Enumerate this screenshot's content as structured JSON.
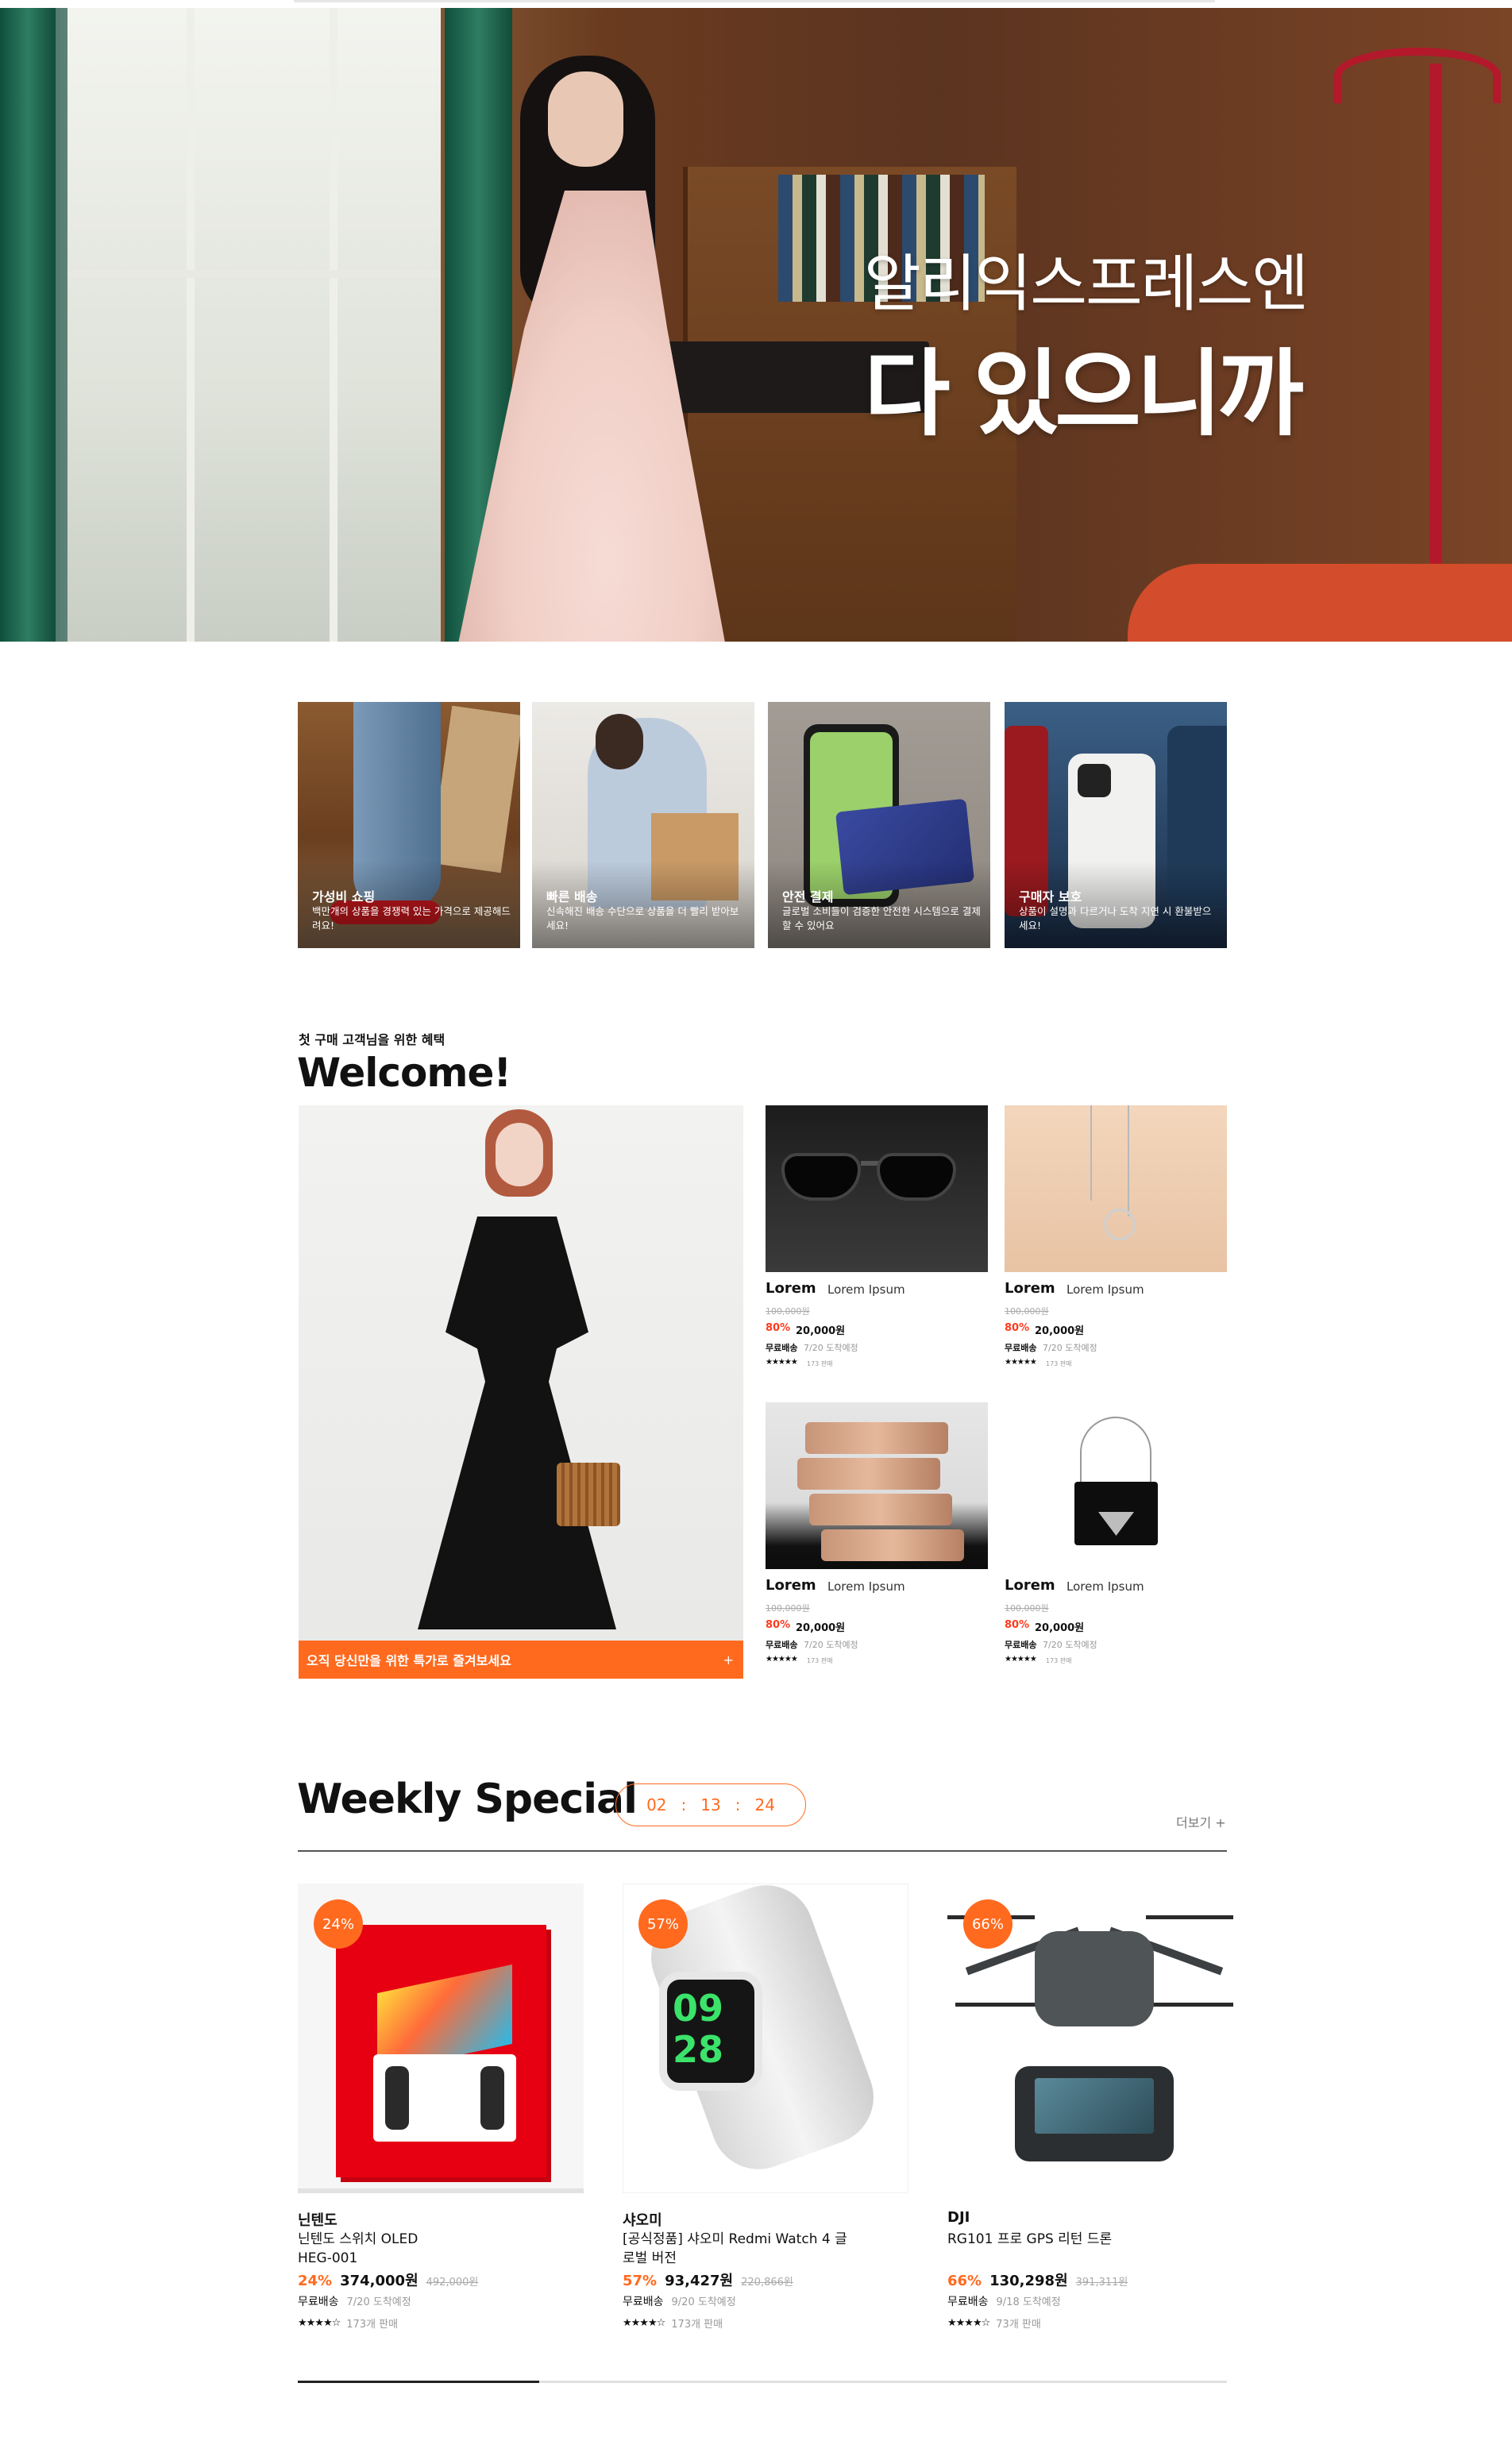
{
  "hero": {
    "title": "알리익스프레스엔",
    "subtitle": "다 있으니까"
  },
  "features": [
    {
      "title": "가성비 쇼핑",
      "desc": "백만개의 상품을 경쟁력 있는 가격으로 제공해드려요!"
    },
    {
      "title": "빠른 배송",
      "desc": "신속해진 배송 수단으로 상품을 더 빨리 받아보세요!"
    },
    {
      "title": "안전 결제",
      "desc": "글로벌 소비들이 검증한 안전한 시스템으로 결제할 수 있어요"
    },
    {
      "title": "구매자 보호",
      "desc": "상품이 설명과 다르거나 도착 지연 시 환불받으세요!"
    }
  ],
  "welcome": {
    "subtitle": "첫 구매 고객님을 위한 혜택",
    "title": "Welcome!",
    "cta": "오직 당신만을 위한 특가로 즐겨보세요",
    "cta_plus": "+",
    "products": [
      {
        "brand": "Lorem",
        "name": "Lorem Ipsum",
        "orig_price": "100,000원",
        "discount": "80%",
        "price": "20,000원",
        "shipping": "무료배송",
        "eta": "7/20 도착예정",
        "stars": "★★★★★",
        "sold": "173 판매"
      },
      {
        "brand": "Lorem",
        "name": "Lorem Ipsum",
        "orig_price": "100,000원",
        "discount": "80%",
        "price": "20,000원",
        "shipping": "무료배송",
        "eta": "7/20 도착예정",
        "stars": "★★★★★",
        "sold": "173 판매"
      },
      {
        "brand": "Lorem",
        "name": "Lorem Ipsum",
        "orig_price": "100,000원",
        "discount": "80%",
        "price": "20,000원",
        "shipping": "무료배송",
        "eta": "7/20 도착예정",
        "stars": "★★★★★",
        "sold": "173 판매"
      },
      {
        "brand": "Lorem",
        "name": "Lorem Ipsum",
        "orig_price": "100,000원",
        "discount": "80%",
        "price": "20,000원",
        "shipping": "무료배송",
        "eta": "7/20 도착예정",
        "stars": "★★★★★",
        "sold": "173 판매"
      }
    ]
  },
  "weekly": {
    "title": "Weekly Special",
    "timer": {
      "h": "02",
      "m": "13",
      "s": "24",
      "sep": ":"
    },
    "more": "더보기 +",
    "progress": 0.26,
    "products": [
      {
        "badge": "24%",
        "brand": "닌텐도",
        "name": "닌텐도 스위치 OLED HEG-001",
        "discount": "24%",
        "price": "374,000원",
        "orig_price": "492,000원",
        "shipping": "무료배송",
        "eta": "7/20 도착예정",
        "stars": "★★★★☆",
        "sold": "173개 판매"
      },
      {
        "badge": "57%",
        "brand": "샤오미",
        "name": "[공식정품] 샤오미 Redmi Watch 4 글로벌 버전",
        "discount": "57%",
        "price": "93,427원",
        "orig_price": "220,866원",
        "shipping": "무료배송",
        "eta": "9/20 도착예정",
        "stars": "★★★★☆",
        "sold": "173개 판매"
      },
      {
        "badge": "66%",
        "brand": "DJI",
        "name": "RG101 프로 GPS 리턴 드론",
        "discount": "66%",
        "price": "130,298원",
        "orig_price": "391,311원",
        "shipping": "무료배송",
        "eta": "9/18 도착예정",
        "stars": "★★★★☆",
        "sold": "73개 판매"
      }
    ]
  },
  "colors": {
    "accent": "#ff6a1f",
    "discount_red": "#ff3b1f"
  }
}
